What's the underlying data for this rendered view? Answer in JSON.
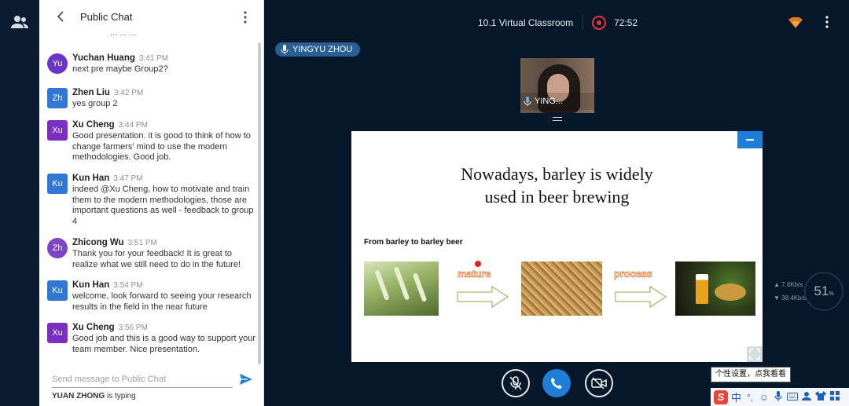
{
  "chat": {
    "title": "Public Chat",
    "partial_text": "... ... ...",
    "messages": [
      {
        "initials": "Yu",
        "name": "Yuchan Huang",
        "time": "3:41 PM",
        "text": "next pre maybe Group2?"
      },
      {
        "initials": "Zh",
        "name": "Zhen Liu",
        "time": "3:42 PM",
        "text": "yes group 2"
      },
      {
        "initials": "Xu",
        "name": "Xu Cheng",
        "time": "3:44 PM",
        "text": "Good presentation. it is good to think of how to change farmers' mind to use the modern methodologies. Good job."
      },
      {
        "initials": "Ku",
        "name": "Kun Han",
        "time": "3:47 PM",
        "text": "indeed @Xu Cheng, how to motivate and train them to the modern methodologies, those are important questions as well - feedback to group 4"
      },
      {
        "initials": "Zh",
        "name": "Zhicong Wu",
        "time": "3:51 PM",
        "text": "Thank you for your feedback! It is great to realize what we still need to do in the future!"
      },
      {
        "initials": "Ku",
        "name": "Kun Han",
        "time": "3:54 PM",
        "text": "welcome, look forward to seeing your research results in the field in the near future"
      },
      {
        "initials": "Xu",
        "name": "Xu Cheng",
        "time": "3:56 PM",
        "text": "Good job and this is a good way to support your team member. Nice presentation."
      }
    ],
    "input_placeholder": "Send message to Public Chat",
    "typing_user": "YUAN ZHONG",
    "typing_suffix": "is typing"
  },
  "topbar": {
    "title": "10.1 Virtual Classroom",
    "timer": "72:52"
  },
  "speaker": {
    "name": "YINGYU ZHOU"
  },
  "video": {
    "label": "YING..."
  },
  "slide": {
    "title_line1": "Nowadays, barley is widely",
    "title_line2": "used in beer brewing",
    "subtitle": "From barley to barley beer",
    "step1": "mature",
    "step2": "process"
  },
  "stats": {
    "upload": "7.6Kb/s",
    "download": "38.4Kb/s",
    "cpu": "51",
    "cpu_unit": "%"
  },
  "ime": {
    "tooltip": "个性设置，点我看看",
    "logo": "S",
    "mode": "中",
    "punct": "°,"
  },
  "colors": {
    "accent": "#1f7fd8",
    "avatar_purple": "#6a35c9",
    "avatar_blue": "#3178d4",
    "avatar_violet": "#7b2ec2",
    "record": "#ee3333"
  }
}
